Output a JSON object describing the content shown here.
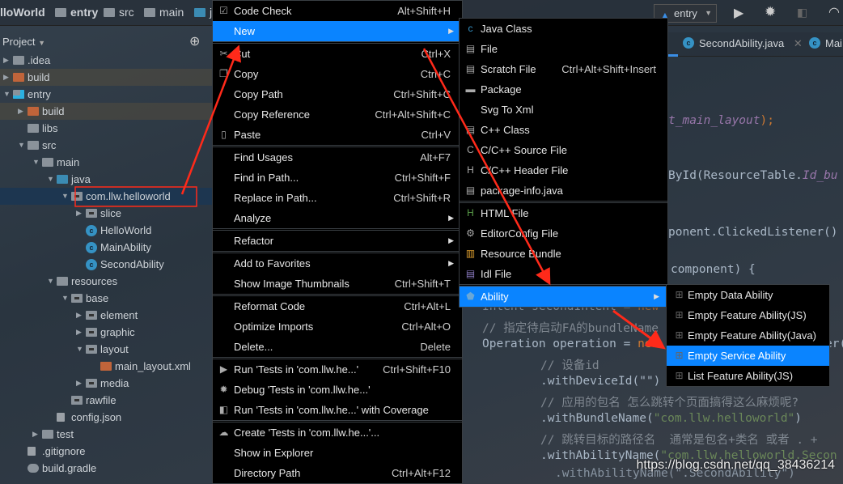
{
  "navbar": {
    "crumbs": [
      "lloWorld",
      "entry",
      "src",
      "main",
      "j"
    ]
  },
  "toolbar": {
    "config": "entry",
    "run_icon": "play-icon",
    "debug_icon": "bug-icon"
  },
  "tabs": [
    {
      "label": "SecondAbility.java"
    },
    {
      "label": "Mai"
    }
  ],
  "project": {
    "title": "Project",
    "tree": [
      {
        "label": ".idea",
        "depth": 0,
        "arrow": "right",
        "icon": "folder"
      },
      {
        "label": "build",
        "depth": 0,
        "arrow": "right",
        "icon": "folder-orange",
        "hl": true
      },
      {
        "label": "entry",
        "depth": 0,
        "arrow": "down",
        "icon": "module"
      },
      {
        "label": "build",
        "depth": 1,
        "arrow": "right",
        "icon": "folder-orange",
        "hl": true
      },
      {
        "label": "libs",
        "depth": 1,
        "arrow": "",
        "icon": "folder"
      },
      {
        "label": "src",
        "depth": 1,
        "arrow": "down",
        "icon": "folder"
      },
      {
        "label": "main",
        "depth": 2,
        "arrow": "down",
        "icon": "folder"
      },
      {
        "label": "java",
        "depth": 3,
        "arrow": "down",
        "icon": "folder-blue"
      },
      {
        "label": "com.llw.helloworld",
        "depth": 4,
        "arrow": "down",
        "icon": "package",
        "selected": true
      },
      {
        "label": "slice",
        "depth": 5,
        "arrow": "right",
        "icon": "package"
      },
      {
        "label": "HelloWorld",
        "depth": 5,
        "arrow": "",
        "icon": "class"
      },
      {
        "label": "MainAbility",
        "depth": 5,
        "arrow": "",
        "icon": "class"
      },
      {
        "label": "SecondAbility",
        "depth": 5,
        "arrow": "",
        "icon": "class"
      },
      {
        "label": "resources",
        "depth": 3,
        "arrow": "down",
        "icon": "folder"
      },
      {
        "label": "base",
        "depth": 4,
        "arrow": "down",
        "icon": "package"
      },
      {
        "label": "element",
        "depth": 5,
        "arrow": "right",
        "icon": "package"
      },
      {
        "label": "graphic",
        "depth": 5,
        "arrow": "right",
        "icon": "package"
      },
      {
        "label": "layout",
        "depth": 5,
        "arrow": "down",
        "icon": "package"
      },
      {
        "label": "main_layout.xml",
        "depth": 6,
        "arrow": "",
        "icon": "xml"
      },
      {
        "label": "media",
        "depth": 5,
        "arrow": "right",
        "icon": "package"
      },
      {
        "label": "rawfile",
        "depth": 4,
        "arrow": "",
        "icon": "package"
      },
      {
        "label": "config.json",
        "depth": 3,
        "arrow": "",
        "icon": "file"
      },
      {
        "label": "test",
        "depth": 2,
        "arrow": "right",
        "icon": "folder"
      },
      {
        "label": ".gitignore",
        "depth": 1,
        "arrow": "",
        "icon": "file"
      },
      {
        "label": "build.gradle",
        "depth": 1,
        "arrow": "",
        "icon": "gradle"
      }
    ]
  },
  "context_menu": [
    {
      "label": "Code Check",
      "shortcut": "Alt+Shift+H",
      "icon": "code-check-icon"
    },
    {
      "label": "New",
      "submenu": true,
      "active": true
    },
    {
      "sep": true
    },
    {
      "label": "Cut",
      "shortcut": "Ctrl+X",
      "icon": "scissors-icon"
    },
    {
      "label": "Copy",
      "shortcut": "Ctrl+C",
      "icon": "copy-icon"
    },
    {
      "label": "Copy Path",
      "shortcut": "Ctrl+Shift+C"
    },
    {
      "label": "Copy Reference",
      "shortcut": "Ctrl+Alt+Shift+C"
    },
    {
      "label": "Paste",
      "shortcut": "Ctrl+V",
      "icon": "clipboard-icon"
    },
    {
      "sep": true
    },
    {
      "label": "Find Usages",
      "shortcut": "Alt+F7"
    },
    {
      "label": "Find in Path...",
      "shortcut": "Ctrl+Shift+F"
    },
    {
      "label": "Replace in Path...",
      "shortcut": "Ctrl+Shift+R"
    },
    {
      "label": "Analyze",
      "submenu": true
    },
    {
      "sep": true
    },
    {
      "label": "Refactor",
      "submenu": true
    },
    {
      "sep": true
    },
    {
      "label": "Add to Favorites",
      "submenu": true
    },
    {
      "label": "Show Image Thumbnails",
      "shortcut": "Ctrl+Shift+T"
    },
    {
      "sep": true
    },
    {
      "label": "Reformat Code",
      "shortcut": "Ctrl+Alt+L"
    },
    {
      "label": "Optimize Imports",
      "shortcut": "Ctrl+Alt+O"
    },
    {
      "label": "Delete...",
      "shortcut": "Delete"
    },
    {
      "sep": true
    },
    {
      "label": "Run 'Tests in 'com.llw.he...'",
      "shortcut": "Ctrl+Shift+F10",
      "icon": "run-icon"
    },
    {
      "label": "Debug 'Tests in 'com.llw.he...'",
      "icon": "bug-icon"
    },
    {
      "label": "Run 'Tests in 'com.llw.he...' with Coverage",
      "icon": "coverage-icon"
    },
    {
      "sep": true
    },
    {
      "label": "Create 'Tests in 'com.llw.he...'...",
      "icon": "gradle-icon"
    },
    {
      "label": "Show in Explorer"
    },
    {
      "label": "Directory Path",
      "shortcut": "Ctrl+Alt+F12"
    }
  ],
  "new_submenu": [
    {
      "label": "Java Class",
      "icon": "java-class-icon"
    },
    {
      "label": "File",
      "icon": "file-icon"
    },
    {
      "label": "Scratch File",
      "shortcut": "Ctrl+Alt+Shift+Insert",
      "icon": "scratch-file-icon"
    },
    {
      "label": "Package",
      "icon": "package-icon"
    },
    {
      "label": "Svg To Xml"
    },
    {
      "label": "C++ Class",
      "icon": "cpp-class-icon"
    },
    {
      "label": "C/C++ Source File",
      "icon": "c-source-icon"
    },
    {
      "label": "C/C++ Header File",
      "icon": "c-header-icon"
    },
    {
      "label": "package-info.java",
      "icon": "java-file-icon"
    },
    {
      "sep": true
    },
    {
      "label": "HTML File",
      "icon": "html-file-icon"
    },
    {
      "label": "EditorConfig File",
      "icon": "gear-icon"
    },
    {
      "label": "Resource Bundle",
      "icon": "resource-bundle-icon"
    },
    {
      "label": "Idl File",
      "icon": "idl-file-icon"
    },
    {
      "sep": true
    },
    {
      "label": "Ability",
      "submenu": true,
      "active": true,
      "icon": "ability-icon"
    }
  ],
  "ability_submenu": [
    {
      "label": "Empty Data Ability"
    },
    {
      "label": "Empty Feature Ability(JS)"
    },
    {
      "label": "Empty Feature Ability(Java)"
    },
    {
      "label": "Empty Service Ability",
      "active": true
    },
    {
      "label": "List Feature Ability(JS)"
    }
  ],
  "code": {
    "l1": "t_main_layout",
    "l1b": ");",
    "l2a": "ById(ResourceTable.",
    "l2b": "Id_bu",
    "l3": "ponent.ClickedListener()",
    "l4": "component) {",
    "l5a": "Intent secondIntent = ",
    "l5b": "new",
    "l6": "// 指定待启动FA的bundleName",
    "l7a": "Operation operation = ",
    "l7b": "new",
    "l7c": "er(",
    "l8": "// 设备id",
    "l9": ".withDeviceId(\"\")",
    "l10": "// 应用的包名 怎么跳转个页面搞得这么麻烦呢?",
    "l11a": ".withBundleName(",
    "l11b": "\"com.llw.helloworld\"",
    "l11c": ")",
    "l12": "// 跳转目标的路径名  通常是包名+类名 或者 . +",
    "l13a": ".withAbilityName(",
    "l13b": "\"com.llw.helloworld.Secon",
    "l14": ".withAbilityName(\".SecondAbility\")"
  },
  "watermark": "https://blog.csdn.net/qq_38436214",
  "colors": {
    "accent": "#0a84ff",
    "annotation": "#ff2a1a",
    "selection": "#1d3650"
  }
}
